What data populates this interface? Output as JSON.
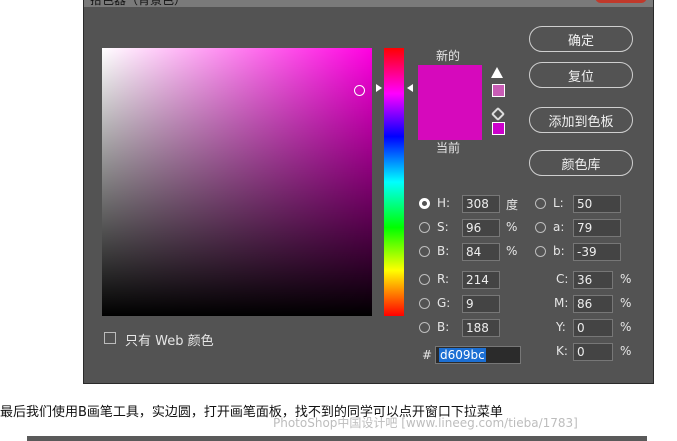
{
  "dialog": {
    "title": "拾色器（背景色）",
    "new_label": "新的",
    "current_label": "当前",
    "new_color": "#d609bc",
    "current_color": "#d609bc",
    "gamut_warning_color": "#c85cb5",
    "websafe_color": "#cc00cc",
    "web_only_label": "只有 Web 颜色"
  },
  "buttons": {
    "ok": "确定",
    "reset": "复位",
    "add_to_swatches": "添加到色板",
    "color_libraries": "颜色库"
  },
  "fields": {
    "H": {
      "label": "H:",
      "value": "308",
      "unit": "度"
    },
    "S": {
      "label": "S:",
      "value": "96",
      "unit": "%"
    },
    "B": {
      "label": "B:",
      "value": "84",
      "unit": "%"
    },
    "R": {
      "label": "R:",
      "value": "214"
    },
    "G": {
      "label": "G:",
      "value": "9"
    },
    "Bl": {
      "label": "B:",
      "value": "188"
    },
    "L": {
      "label": "L:",
      "value": "50"
    },
    "a": {
      "label": "a:",
      "value": "79"
    },
    "b": {
      "label": "b:",
      "value": "-39"
    },
    "C": {
      "label": "C:",
      "value": "36",
      "unit": "%"
    },
    "M": {
      "label": "M:",
      "value": "86",
      "unit": "%"
    },
    "Y": {
      "label": "Y:",
      "value": "0",
      "unit": "%"
    },
    "K": {
      "label": "K:",
      "value": "0",
      "unit": "%"
    },
    "hex": {
      "label": "#",
      "value": "d609bc"
    }
  },
  "caption": "最后我们使用B画笔工具，实边圆，打开画笔面板，找不到的同学可以点开窗口下拉菜单",
  "watermark": "PhotoShop中国设计吧 [www.lineeg.com/tieba/1783]"
}
